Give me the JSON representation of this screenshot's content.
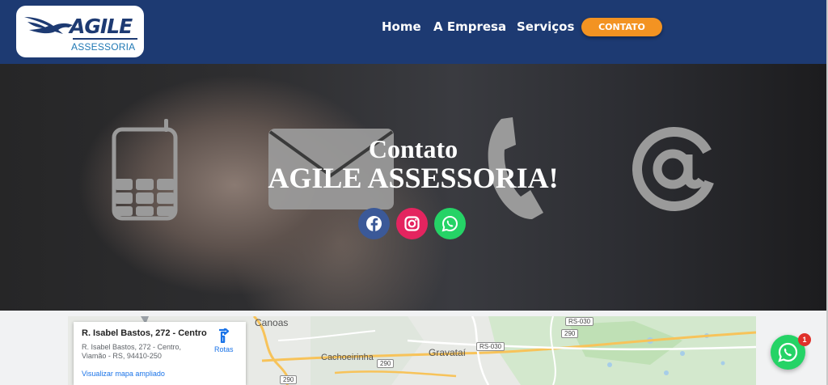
{
  "header": {
    "logo": {
      "name": "AGILE",
      "subtitle": "ASSESSORIA"
    },
    "nav": [
      {
        "label": "Home"
      },
      {
        "label": "A Empresa"
      },
      {
        "label": "Serviços"
      }
    ],
    "cta_label": "CONTATO"
  },
  "hero": {
    "title_line1": "Contato",
    "title_line2": "AGILE ASSESSORIA!",
    "decor_icons": [
      "cellphone-icon",
      "envelope-icon",
      "phone-icon",
      "at-sign-icon"
    ],
    "social": [
      {
        "name": "facebook-icon",
        "color": "#3b5998"
      },
      {
        "name": "instagram-icon",
        "color": "#e4245f"
      },
      {
        "name": "whatsapp-icon",
        "color": "#25d366"
      }
    ]
  },
  "map": {
    "card": {
      "title": "R. Isabel Bastos, 272 - Centro",
      "address": "R. Isabel Bastos, 272 - Centro, Viamão - RS, 94410-250",
      "directions_label": "Rotas",
      "larger_map_link": "Visualizar mapa ampliado"
    },
    "places": [
      "Canoas",
      "Cachoeirinha",
      "Gravataí"
    ],
    "road_badges": [
      "RS-030",
      "290",
      "RS-030",
      "290",
      "290"
    ]
  },
  "whatsapp_float": {
    "badge_count": "1"
  },
  "colors": {
    "header_bg": "#1d3a72",
    "cta_bg": "#f39322",
    "link_blue": "#1a73e8"
  }
}
